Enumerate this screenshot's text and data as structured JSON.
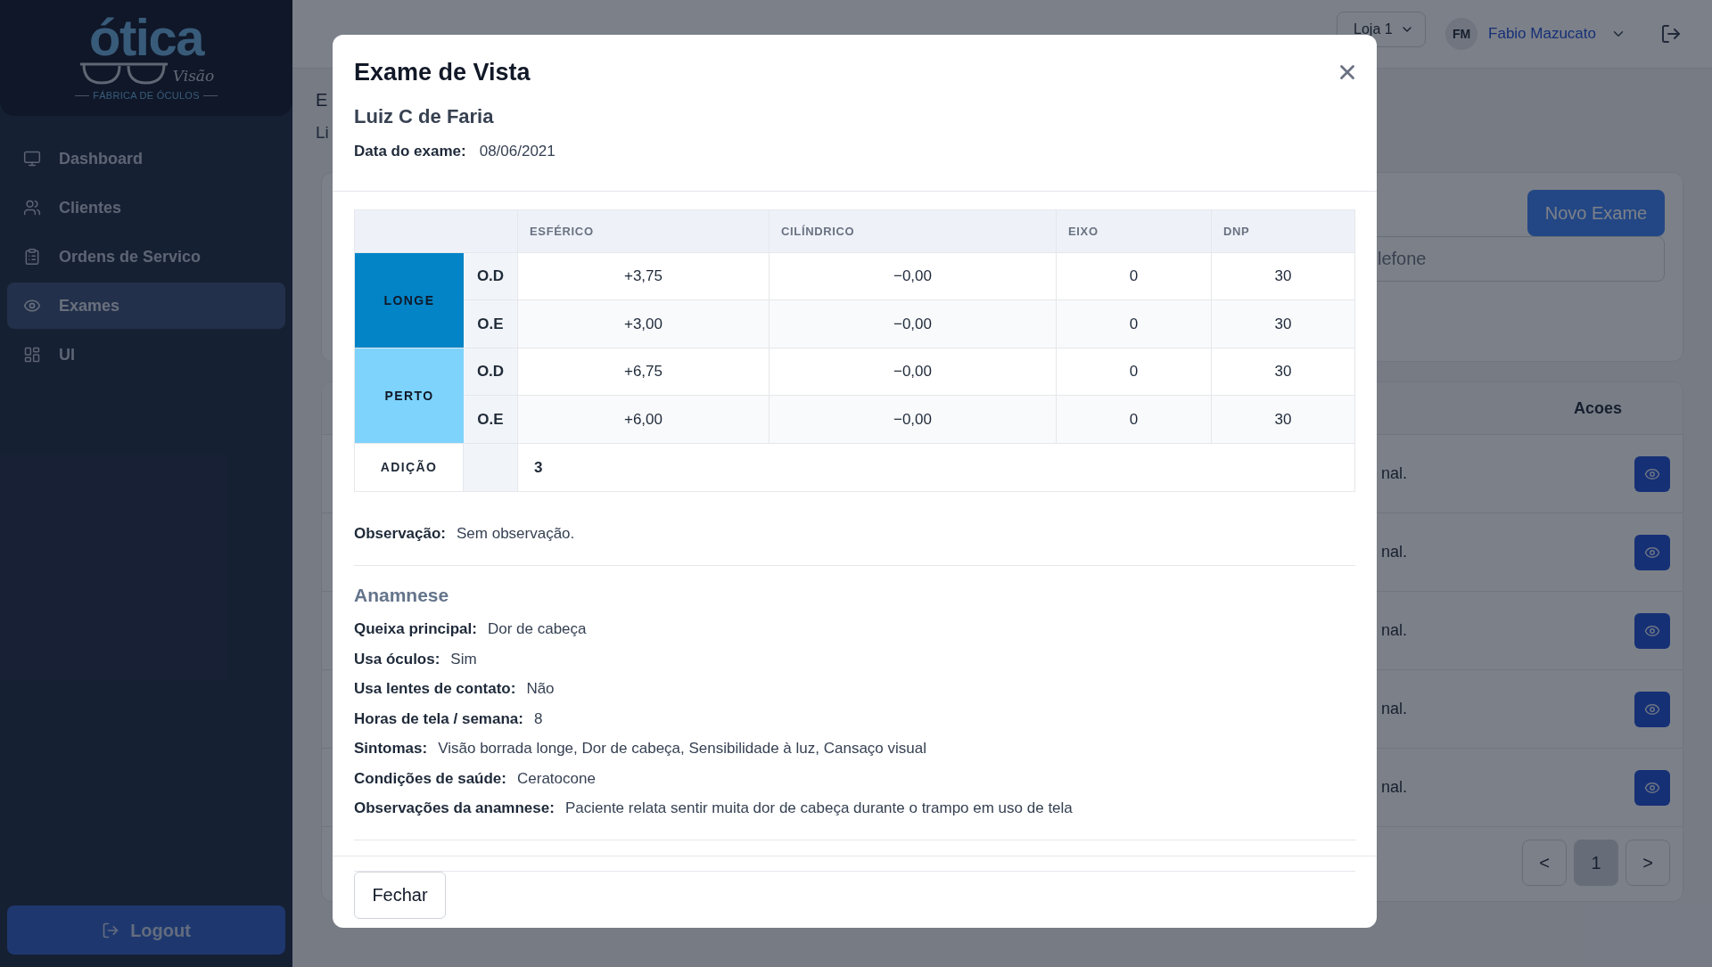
{
  "sidebar": {
    "logo": {
      "word": "ótica",
      "script": "Visão",
      "tagline": "FÁBRICA DE ÓCULOS"
    },
    "items": [
      {
        "label": "Dashboard",
        "selected": false
      },
      {
        "label": "Clientes",
        "selected": false
      },
      {
        "label": "Ordens de Servico",
        "selected": false
      },
      {
        "label": "Exames",
        "selected": true
      },
      {
        "label": "UI",
        "selected": false
      }
    ],
    "logout": "Logout"
  },
  "header": {
    "store_select": "Loja 1",
    "user": {
      "initials": "FM",
      "name": "Fabio Mazucato"
    }
  },
  "page": {
    "title": "E",
    "subtitle": "Li",
    "new_button": "Novo Exame",
    "search": {
      "placeholder": "lefone"
    },
    "table": {
      "actions_header": "Acoes",
      "rows": [
        {
          "column_2": "nal."
        },
        {
          "column_2": "nal."
        },
        {
          "column_2": "nal."
        },
        {
          "column_2": "nal."
        },
        {
          "column_2": "nal."
        }
      ]
    },
    "pagination": [
      {
        "label": "<",
        "selected": false
      },
      {
        "label": "1",
        "selected": true
      },
      {
        "label": ">",
        "selected": false
      }
    ]
  },
  "modal": {
    "title": "Exame de Vista",
    "patient": "Luiz C de Faria",
    "date": {
      "label": "Data do exame:",
      "value": "08/06/2021"
    },
    "prescription": {
      "columns": [
        "ESFÉRICO",
        "CILÍNDRICO",
        "EIXO",
        "DNP"
      ],
      "groups": [
        {
          "label": "LONGE",
          "color": "#0284c7",
          "rows": [
            {
              "eye": "O.D",
              "values": [
                "+3,75",
                "−0,00",
                "0",
                "30"
              ]
            },
            {
              "eye": "O.E",
              "values": [
                "+3,00",
                "−0,00",
                "0",
                "30"
              ]
            }
          ]
        },
        {
          "label": "PERTO",
          "color": "#7dd3fc",
          "rows": [
            {
              "eye": "O.D",
              "values": [
                "+6,75",
                "−0,00",
                "0",
                "30"
              ]
            },
            {
              "eye": "O.E",
              "values": [
                "+6,00",
                "−0,00",
                "0",
                "30"
              ]
            }
          ]
        }
      ],
      "addition": {
        "label": "ADIÇÃO",
        "value": "3"
      }
    },
    "observation": {
      "label": "Observação:",
      "value": "Sem observação."
    },
    "anamnese": {
      "title": "Anamnese",
      "fields": [
        {
          "label": "Queixa principal:",
          "value": "Dor de cabeça"
        },
        {
          "label": "Usa óculos:",
          "value": "Sim"
        },
        {
          "label": "Usa lentes de contato:",
          "value": "Não"
        },
        {
          "label": "Horas de tela / semana:",
          "value": "8"
        },
        {
          "label": "Sintomas:",
          "value": "Visão borrada longe, Dor de cabeça, Sensibilidade à luz, Cansaço visual"
        },
        {
          "label": "Condições de saúde:",
          "value": "Ceratocone"
        },
        {
          "label": "Observações da anamnese:",
          "value": "Paciente relata sentir muita dor de cabeça durante o trampo em uso de tela"
        }
      ]
    },
    "close_button": "Fechar"
  }
}
